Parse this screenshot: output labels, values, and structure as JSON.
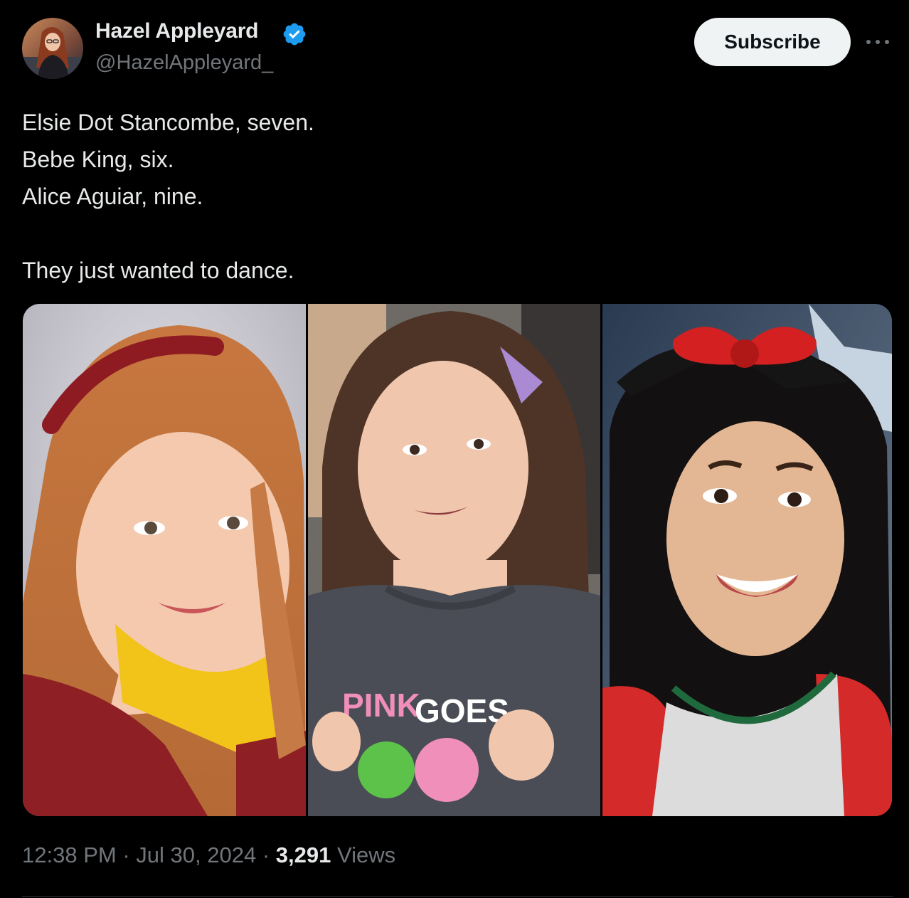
{
  "author": {
    "display_name": "Hazel Appleyard",
    "handle": "@HazelAppleyard_",
    "verified_icon": "verified-badge-icon",
    "verified_color": "#1d9bf0"
  },
  "actions": {
    "subscribe_label": "Subscribe",
    "more_icon": "more-options-icon"
  },
  "tweet": {
    "lines": [
      "Elsie Dot Stancombe, seven.",
      "Bebe King, six.",
      "Alice Aguiar, nine.",
      "They just wanted to dance."
    ]
  },
  "media": {
    "photo_count": 3,
    "shirt_text_pink": "PINK",
    "shirt_text_goes": "GOES"
  },
  "meta": {
    "time": "12:38 PM",
    "separator": "·",
    "date": "Jul 30, 2024",
    "views_count": "3,291",
    "views_label": "Views"
  },
  "colors": {
    "background": "#000000",
    "text_primary": "#e7e9ea",
    "text_secondary": "#71767b",
    "button_bg": "#eff3f4",
    "accent": "#1d9bf0"
  }
}
